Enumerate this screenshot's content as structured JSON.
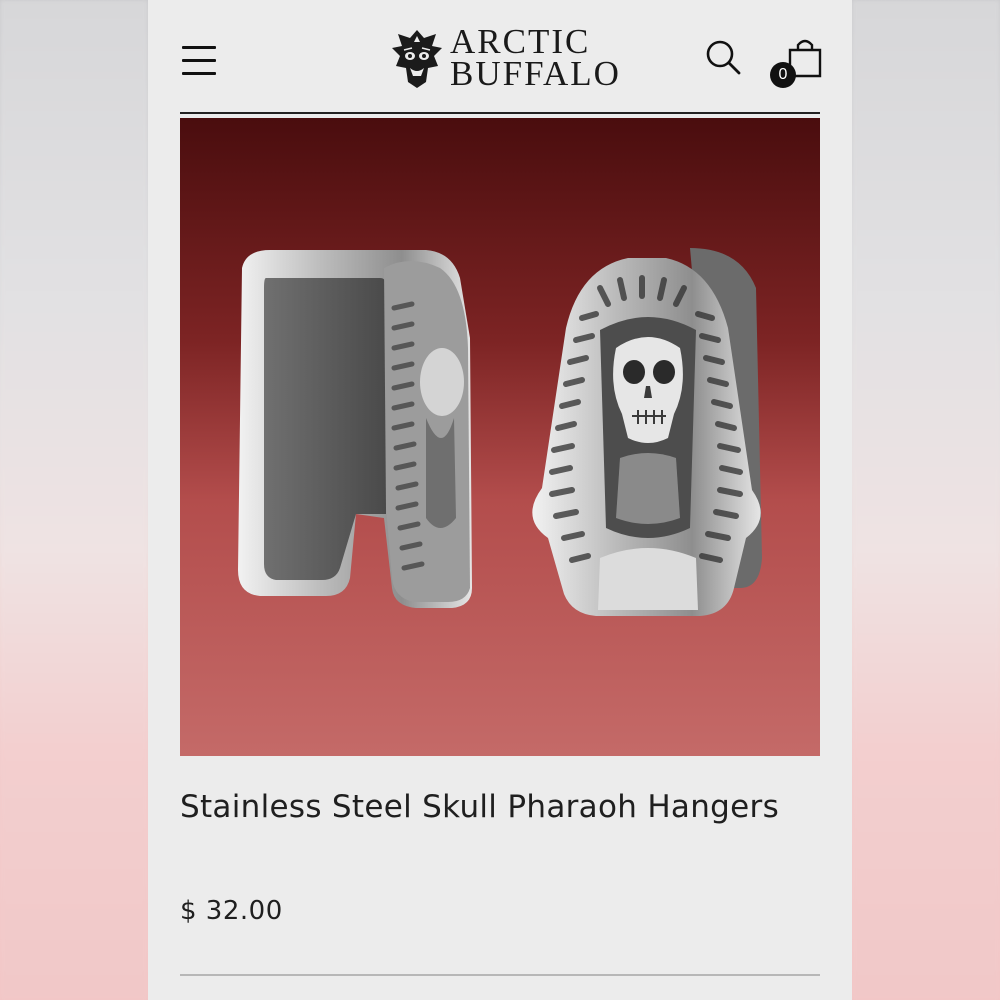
{
  "header": {
    "logo_line1": "ARCTIC",
    "logo_line2": "BUFFALO",
    "cart_count": "0"
  },
  "icons": {
    "menu": "hamburger-menu-icon",
    "search": "search-icon",
    "cart": "shopping-bag-icon",
    "logo": "buffalo-mask-icon"
  },
  "product": {
    "title": "Stainless Steel Skull Pharaoh Hangers",
    "price": "$ 32.00"
  },
  "colors": {
    "text": "#1f1f1f",
    "background": "#ececec",
    "photo_background": "#b0504e"
  }
}
